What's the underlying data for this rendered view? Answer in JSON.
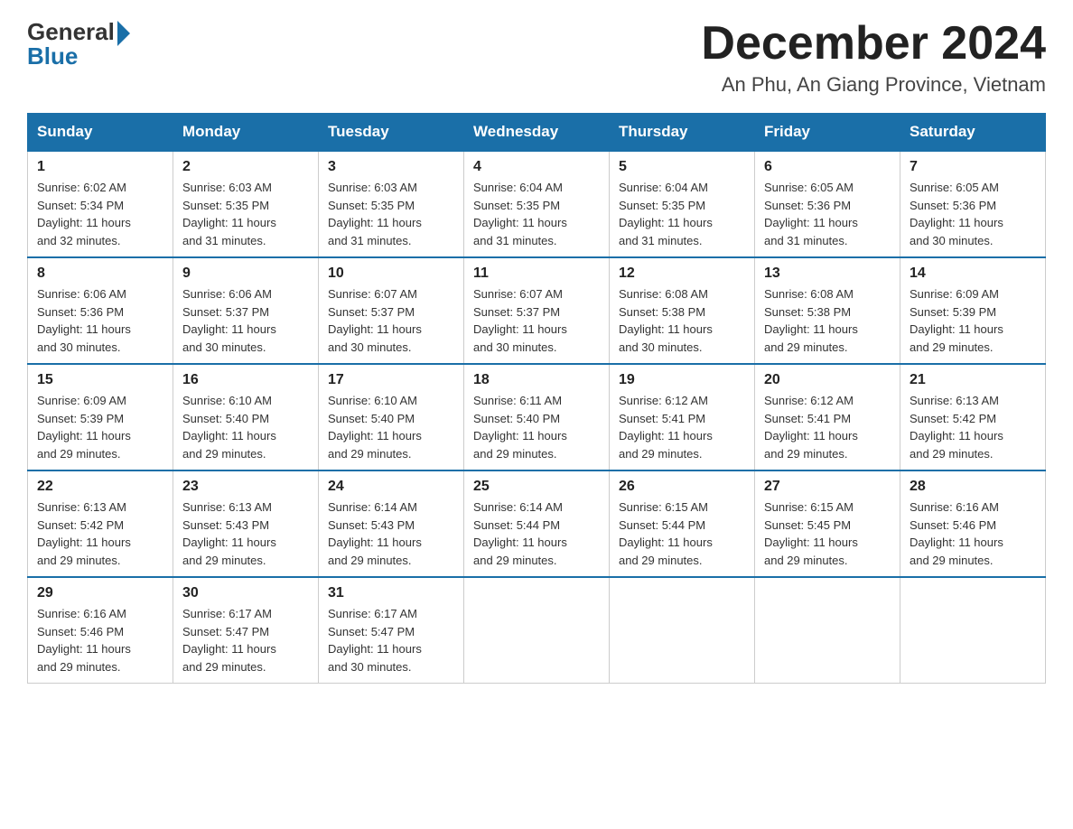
{
  "logo": {
    "general": "General",
    "blue": "Blue"
  },
  "title": {
    "month": "December 2024",
    "location": "An Phu, An Giang Province, Vietnam"
  },
  "headers": [
    "Sunday",
    "Monday",
    "Tuesday",
    "Wednesday",
    "Thursday",
    "Friday",
    "Saturday"
  ],
  "weeks": [
    [
      {
        "day": "1",
        "sunrise": "6:02 AM",
        "sunset": "5:34 PM",
        "daylight": "11 hours and 32 minutes."
      },
      {
        "day": "2",
        "sunrise": "6:03 AM",
        "sunset": "5:35 PM",
        "daylight": "11 hours and 31 minutes."
      },
      {
        "day": "3",
        "sunrise": "6:03 AM",
        "sunset": "5:35 PM",
        "daylight": "11 hours and 31 minutes."
      },
      {
        "day": "4",
        "sunrise": "6:04 AM",
        "sunset": "5:35 PM",
        "daylight": "11 hours and 31 minutes."
      },
      {
        "day": "5",
        "sunrise": "6:04 AM",
        "sunset": "5:35 PM",
        "daylight": "11 hours and 31 minutes."
      },
      {
        "day": "6",
        "sunrise": "6:05 AM",
        "sunset": "5:36 PM",
        "daylight": "11 hours and 31 minutes."
      },
      {
        "day": "7",
        "sunrise": "6:05 AM",
        "sunset": "5:36 PM",
        "daylight": "11 hours and 30 minutes."
      }
    ],
    [
      {
        "day": "8",
        "sunrise": "6:06 AM",
        "sunset": "5:36 PM",
        "daylight": "11 hours and 30 minutes."
      },
      {
        "day": "9",
        "sunrise": "6:06 AM",
        "sunset": "5:37 PM",
        "daylight": "11 hours and 30 minutes."
      },
      {
        "day": "10",
        "sunrise": "6:07 AM",
        "sunset": "5:37 PM",
        "daylight": "11 hours and 30 minutes."
      },
      {
        "day": "11",
        "sunrise": "6:07 AM",
        "sunset": "5:37 PM",
        "daylight": "11 hours and 30 minutes."
      },
      {
        "day": "12",
        "sunrise": "6:08 AM",
        "sunset": "5:38 PM",
        "daylight": "11 hours and 30 minutes."
      },
      {
        "day": "13",
        "sunrise": "6:08 AM",
        "sunset": "5:38 PM",
        "daylight": "11 hours and 29 minutes."
      },
      {
        "day": "14",
        "sunrise": "6:09 AM",
        "sunset": "5:39 PM",
        "daylight": "11 hours and 29 minutes."
      }
    ],
    [
      {
        "day": "15",
        "sunrise": "6:09 AM",
        "sunset": "5:39 PM",
        "daylight": "11 hours and 29 minutes."
      },
      {
        "day": "16",
        "sunrise": "6:10 AM",
        "sunset": "5:40 PM",
        "daylight": "11 hours and 29 minutes."
      },
      {
        "day": "17",
        "sunrise": "6:10 AM",
        "sunset": "5:40 PM",
        "daylight": "11 hours and 29 minutes."
      },
      {
        "day": "18",
        "sunrise": "6:11 AM",
        "sunset": "5:40 PM",
        "daylight": "11 hours and 29 minutes."
      },
      {
        "day": "19",
        "sunrise": "6:12 AM",
        "sunset": "5:41 PM",
        "daylight": "11 hours and 29 minutes."
      },
      {
        "day": "20",
        "sunrise": "6:12 AM",
        "sunset": "5:41 PM",
        "daylight": "11 hours and 29 minutes."
      },
      {
        "day": "21",
        "sunrise": "6:13 AM",
        "sunset": "5:42 PM",
        "daylight": "11 hours and 29 minutes."
      }
    ],
    [
      {
        "day": "22",
        "sunrise": "6:13 AM",
        "sunset": "5:42 PM",
        "daylight": "11 hours and 29 minutes."
      },
      {
        "day": "23",
        "sunrise": "6:13 AM",
        "sunset": "5:43 PM",
        "daylight": "11 hours and 29 minutes."
      },
      {
        "day": "24",
        "sunrise": "6:14 AM",
        "sunset": "5:43 PM",
        "daylight": "11 hours and 29 minutes."
      },
      {
        "day": "25",
        "sunrise": "6:14 AM",
        "sunset": "5:44 PM",
        "daylight": "11 hours and 29 minutes."
      },
      {
        "day": "26",
        "sunrise": "6:15 AM",
        "sunset": "5:44 PM",
        "daylight": "11 hours and 29 minutes."
      },
      {
        "day": "27",
        "sunrise": "6:15 AM",
        "sunset": "5:45 PM",
        "daylight": "11 hours and 29 minutes."
      },
      {
        "day": "28",
        "sunrise": "6:16 AM",
        "sunset": "5:46 PM",
        "daylight": "11 hours and 29 minutes."
      }
    ],
    [
      {
        "day": "29",
        "sunrise": "6:16 AM",
        "sunset": "5:46 PM",
        "daylight": "11 hours and 29 minutes."
      },
      {
        "day": "30",
        "sunrise": "6:17 AM",
        "sunset": "5:47 PM",
        "daylight": "11 hours and 29 minutes."
      },
      {
        "day": "31",
        "sunrise": "6:17 AM",
        "sunset": "5:47 PM",
        "daylight": "11 hours and 30 minutes."
      },
      null,
      null,
      null,
      null
    ]
  ],
  "labels": {
    "sunrise": "Sunrise:",
    "sunset": "Sunset:",
    "daylight": "Daylight:"
  }
}
